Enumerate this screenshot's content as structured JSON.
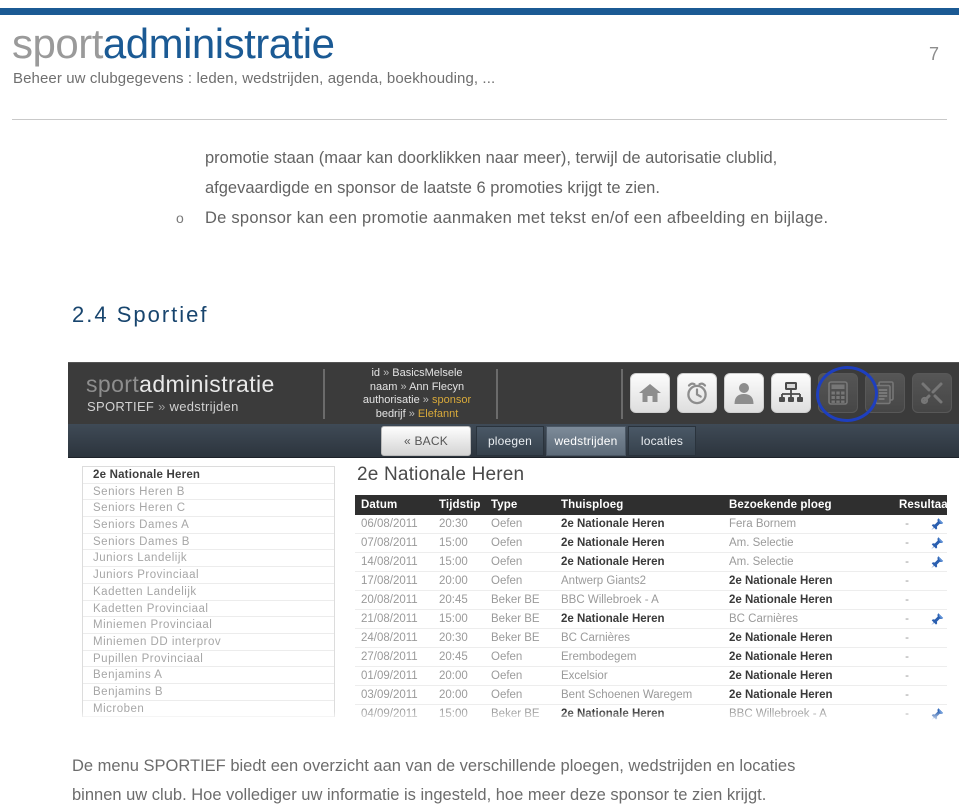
{
  "header": {
    "brand_part1": "sport",
    "brand_part2": "administratie",
    "tagline": "Beheer uw clubgegevens : leden, wedstrijden, agenda, boekhouding, ...",
    "page_number": "7",
    "accent_color": "#1b5a94"
  },
  "body": {
    "paragraph_line1": "promotie staan (maar kan doorklikken naar meer), terwijl de autorisatie clublid,",
    "paragraph_line2": "afgevaardigde en sponsor de laatste 6 promoties krijgt te zien.",
    "bullet_marker": "o",
    "bullet_text": "De sponsor kan een promotie aanmaken met tekst en/of een afbeelding en bijlage.",
    "section_heading": "2.4 Sportief",
    "section_heading_color": "#18456e"
  },
  "app": {
    "brand_part1": "sport",
    "brand_part2": "administratie",
    "breadcrumb_section": "SPORTIEF",
    "breadcrumb_chevron": "»",
    "breadcrumb_page": "wedstrijden",
    "user_info": [
      {
        "key": "id",
        "arrow": "»",
        "value": "BasicsMelsele",
        "highlight": false
      },
      {
        "key": "naam",
        "arrow": "»",
        "value": "Ann Flecyn",
        "highlight": false
      },
      {
        "key": "authorisatie",
        "arrow": "»",
        "value": "sponsor",
        "highlight": true
      },
      {
        "key": "bedrijf",
        "arrow": "»",
        "value": "Elefannt",
        "highlight": true
      }
    ],
    "highlight_color": "#d8a93a",
    "icons": [
      {
        "name": "home-icon",
        "enabled": true
      },
      {
        "name": "alarm-clock-icon",
        "enabled": true
      },
      {
        "name": "person-icon",
        "enabled": true
      },
      {
        "name": "org-chart-icon",
        "enabled": true,
        "selected": true
      },
      {
        "name": "calculator-icon",
        "enabled": false
      },
      {
        "name": "document-icon",
        "enabled": false
      },
      {
        "name": "tools-icon",
        "enabled": false
      }
    ],
    "selection_ring_color": "#1e3fbf",
    "nav": {
      "back_label": "« BACK",
      "tab1_label": "ploegen",
      "tab2_label": "wedstrijden",
      "tab3_label": "locaties",
      "active_tab": "wedstrijden"
    },
    "sidebar_items": [
      "2e Nationale Heren",
      "Seniors Heren B",
      "Seniors Heren C",
      "Seniors Dames A",
      "Seniors Dames B",
      "Juniors Landelijk",
      "Juniors Provinciaal",
      "Kadetten Landelijk",
      "Kadetten Provinciaal",
      "Miniemen Provinciaal",
      "Miniemen DD interprov",
      "Pupillen Provinciaal",
      "Benjamins A",
      "Benjamins B",
      "Microben"
    ],
    "sidebar_active_index": 0,
    "table": {
      "title": "2e Nationale Heren",
      "columns": [
        "Datum",
        "Tijdstip",
        "Type",
        "Thuisploeg",
        "Bezoekende ploeg",
        "Resultaat"
      ],
      "rows": [
        {
          "datum": "06/08/2011",
          "tijdstip": "20:30",
          "type": "Oefen",
          "thuisploeg": "2e Nationale Heren",
          "thuis_bold": true,
          "bezoekende": "Fera Bornem",
          "bezoek_bold": false,
          "resultaat": "-",
          "pin": true
        },
        {
          "datum": "07/08/2011",
          "tijdstip": "15:00",
          "type": "Oefen",
          "thuisploeg": "2e Nationale Heren",
          "thuis_bold": true,
          "bezoekende": "Am. Selectie",
          "bezoek_bold": false,
          "resultaat": "-",
          "pin": true
        },
        {
          "datum": "14/08/2011",
          "tijdstip": "15:00",
          "type": "Oefen",
          "thuisploeg": "2e Nationale Heren",
          "thuis_bold": true,
          "bezoekende": "Am. Selectie",
          "bezoek_bold": false,
          "resultaat": "-",
          "pin": true
        },
        {
          "datum": "17/08/2011",
          "tijdstip": "20:00",
          "type": "Oefen",
          "thuisploeg": "Antwerp Giants2",
          "thuis_bold": false,
          "bezoekende": "2e Nationale Heren",
          "bezoek_bold": true,
          "resultaat": "-",
          "pin": false
        },
        {
          "datum": "20/08/2011",
          "tijdstip": "20:45",
          "type": "Beker BE",
          "thuisploeg": "BBC Willebroek - A",
          "thuis_bold": false,
          "bezoekende": "2e Nationale Heren",
          "bezoek_bold": true,
          "resultaat": "-",
          "pin": false
        },
        {
          "datum": "21/08/2011",
          "tijdstip": "15:00",
          "type": "Beker BE",
          "thuisploeg": "2e Nationale Heren",
          "thuis_bold": true,
          "bezoekende": "BC Carnières",
          "bezoek_bold": false,
          "resultaat": "-",
          "pin": true
        },
        {
          "datum": "24/08/2011",
          "tijdstip": "20:30",
          "type": "Beker BE",
          "thuisploeg": "BC Carnières",
          "thuis_bold": false,
          "bezoekende": "2e Nationale Heren",
          "bezoek_bold": true,
          "resultaat": "-",
          "pin": false
        },
        {
          "datum": "27/08/2011",
          "tijdstip": "20:45",
          "type": "Oefen",
          "thuisploeg": "Erembodegem",
          "thuis_bold": false,
          "bezoekende": "2e Nationale Heren",
          "bezoek_bold": true,
          "resultaat": "-",
          "pin": false
        },
        {
          "datum": "01/09/2011",
          "tijdstip": "20:00",
          "type": "Oefen",
          "thuisploeg": "Excelsior",
          "thuis_bold": false,
          "bezoekende": "2e Nationale Heren",
          "bezoek_bold": true,
          "resultaat": "-",
          "pin": false
        },
        {
          "datum": "03/09/2011",
          "tijdstip": "20:00",
          "type": "Oefen",
          "thuisploeg": "Bent Schoenen Waregem",
          "thuis_bold": false,
          "bezoekende": "2e Nationale Heren",
          "bezoek_bold": true,
          "resultaat": "-",
          "pin": false
        },
        {
          "datum": "04/09/2011",
          "tijdstip": "15:00",
          "type": "Beker BE",
          "thuisploeg": "2e Nationale Heren",
          "thuis_bold": true,
          "bezoekende": "BBC Willebroek - A",
          "bezoek_bold": false,
          "resultaat": "-",
          "pin": true
        }
      ]
    }
  },
  "footer": {
    "line1": "De menu SPORTIEF biedt een overzicht aan van de verschillende ploegen, wedstrijden en locaties",
    "line2": "binnen uw club. Hoe vollediger uw informatie is ingesteld, hoe meer deze sponsor te zien krijgt."
  }
}
